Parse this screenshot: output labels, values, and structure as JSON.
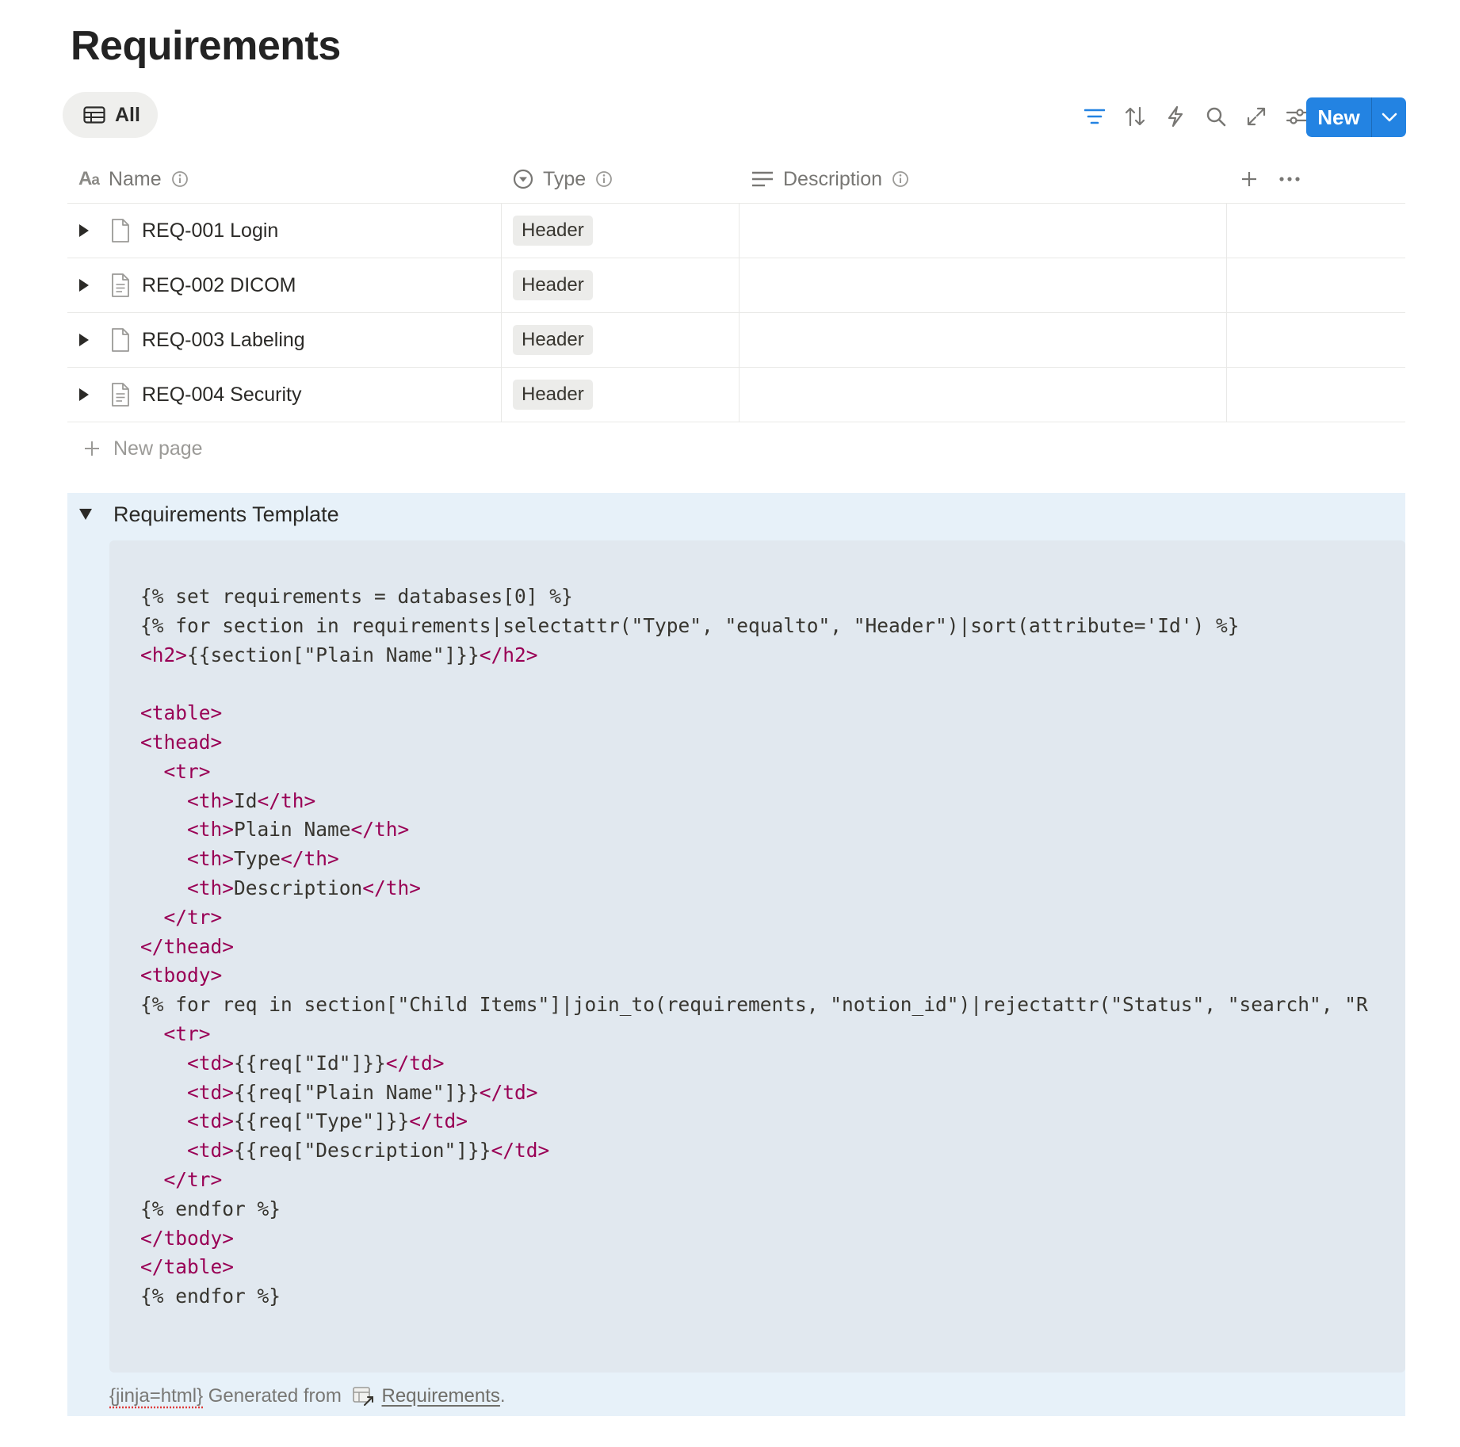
{
  "page": {
    "title": "Requirements"
  },
  "view": {
    "tab_label": "All"
  },
  "toolbar": {
    "new_label": "New",
    "icons": [
      "filter-icon",
      "sort-icon",
      "lightning-icon",
      "search-icon",
      "expand-icon",
      "settings-icon"
    ],
    "accent": "#2383e2"
  },
  "table": {
    "columns": [
      {
        "label": "Name",
        "icon": "text-type-icon"
      },
      {
        "label": "Type",
        "icon": "select-icon"
      },
      {
        "label": "Description",
        "icon": "lines-icon"
      }
    ],
    "rows": [
      {
        "name": "REQ-001 Login",
        "type": "Header",
        "icon": "page-icon"
      },
      {
        "name": "REQ-002 DICOM",
        "type": "Header",
        "icon": "page-text-icon"
      },
      {
        "name": "REQ-003 Labeling",
        "type": "Header",
        "icon": "page-icon"
      },
      {
        "name": "REQ-004 Security",
        "type": "Header",
        "icon": "page-text-icon"
      }
    ],
    "new_page_label": "New page"
  },
  "template": {
    "title": "Requirements Template",
    "code_lines": [
      "{% set requirements = databases[0] %}",
      "{% for section in requirements|selectattr(\"Type\", \"equalto\", \"Header\")|sort(attribute='Id') %}",
      "<h2>{{section[\"Plain Name\"]}}</h2>",
      "",
      "<table>",
      "<thead>",
      "  <tr>",
      "    <th>Id</th>",
      "    <th>Plain Name</th>",
      "    <th>Type</th>",
      "    <th>Description</th>",
      "  </tr>",
      "</thead>",
      "<tbody>",
      "{% for req in section[\"Child Items\"]|join_to(requirements, \"notion_id\")|rejectattr(\"Status\", \"search\", \"R",
      "  <tr>",
      "    <td>{{req[\"Id\"]}}</td>",
      "    <td>{{req[\"Plain Name\"]}}</td>",
      "    <td>{{req[\"Type\"]}}</td>",
      "    <td>{{req[\"Description\"]}}</td>",
      "  </tr>",
      "{% endfor %}",
      "</tbody>",
      "</table>",
      "{% endfor %}"
    ],
    "footer_prefix": "{jinja=html}",
    "footer_middle": " Generated from ",
    "footer_link": "Requirements",
    "footer_suffix": "."
  }
}
